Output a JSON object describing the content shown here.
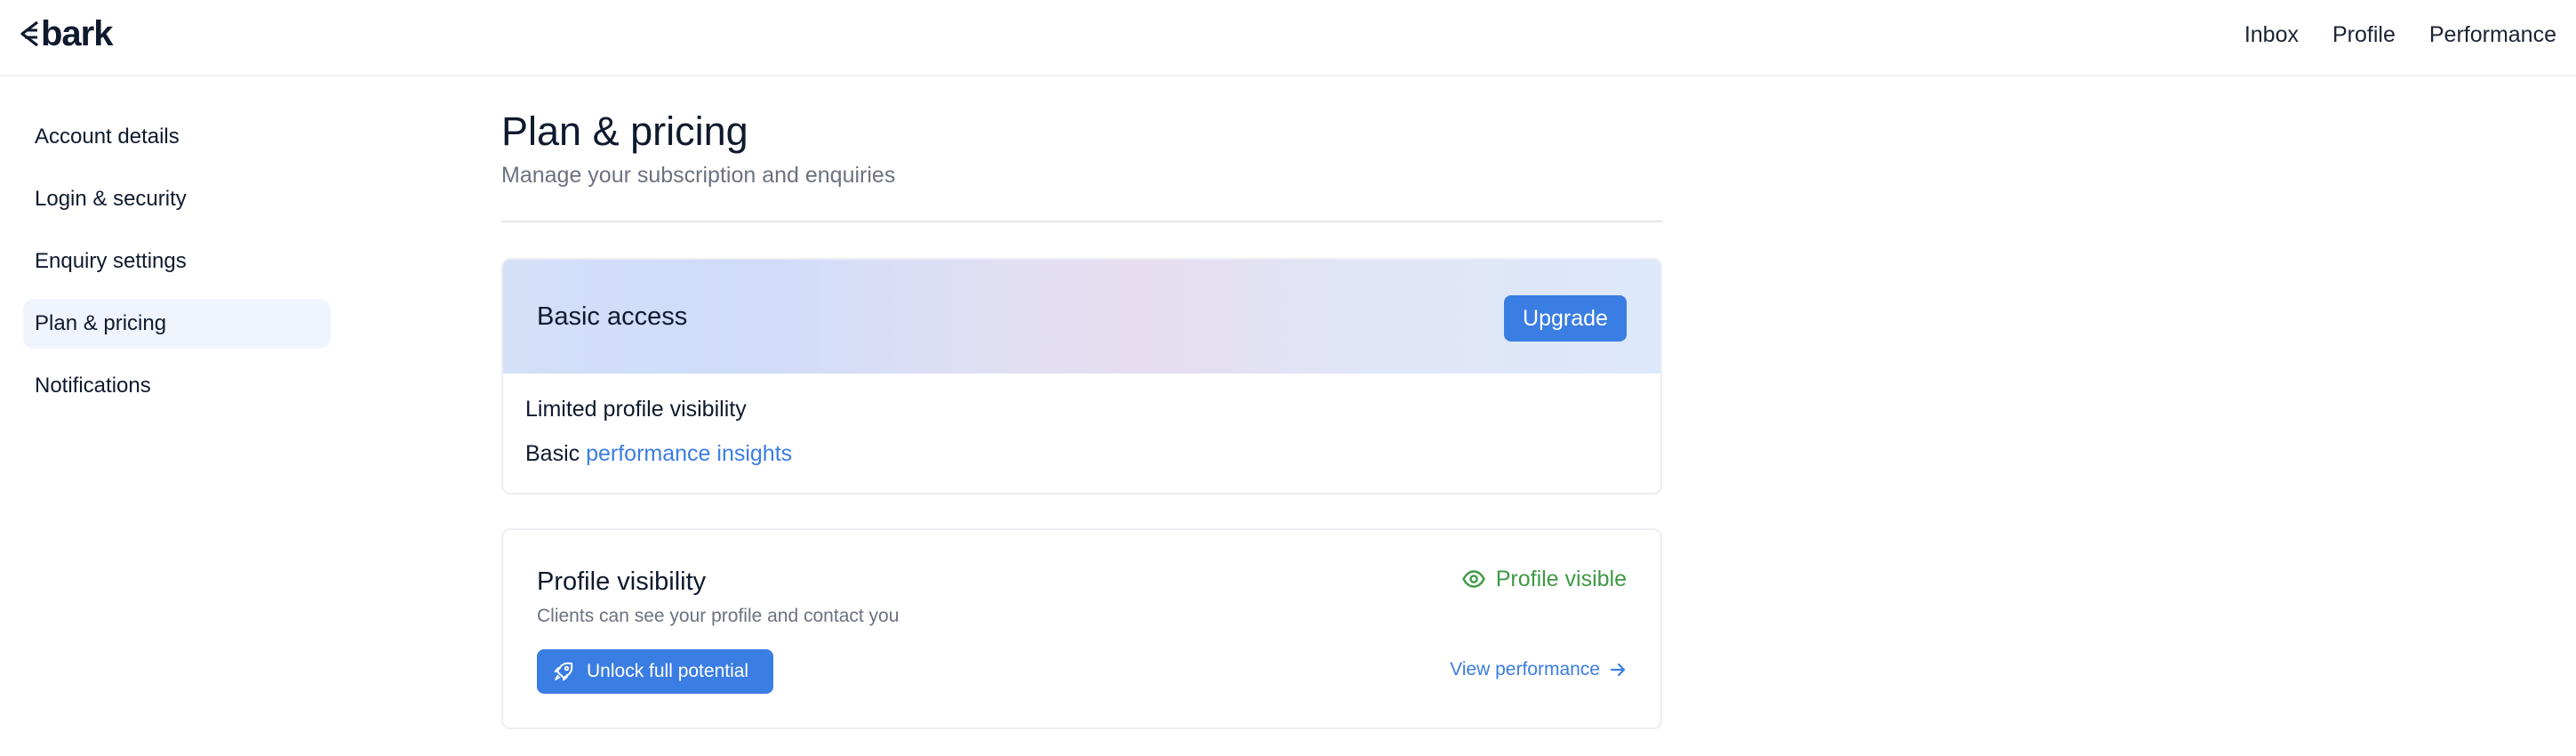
{
  "app": {
    "logo_text": "bark"
  },
  "topnav": {
    "items": [
      "Inbox",
      "Profile",
      "Performance"
    ]
  },
  "sidebar": {
    "items": [
      {
        "label": "Account details",
        "active": false
      },
      {
        "label": "Login & security",
        "active": false
      },
      {
        "label": "Enquiry settings",
        "active": false
      },
      {
        "label": "Plan & pricing",
        "active": true
      },
      {
        "label": "Notifications",
        "active": false
      }
    ]
  },
  "page": {
    "title": "Plan & pricing",
    "subtitle": "Manage your subscription and enquiries"
  },
  "plan": {
    "name": "Basic access",
    "upgrade_label": "Upgrade",
    "feature_1": "Limited profile visibility",
    "feature_2_prefix": "Basic",
    "feature_2_link": "performance insights"
  },
  "visibility": {
    "title": "Profile visibility",
    "description": "Clients can see your profile and contact you",
    "status": "Profile visible",
    "status_icon": "eye-icon",
    "unlock_label": "Unlock full potential",
    "unlock_icon": "rocket-icon",
    "view_performance_label": "View performance",
    "view_performance_icon": "arrow-right-icon"
  },
  "colors": {
    "accent": "#3a7de3",
    "success": "#3f9a45",
    "text": "#0f1a2e",
    "muted": "#6b7280",
    "active_bg": "#f0f5fd"
  }
}
